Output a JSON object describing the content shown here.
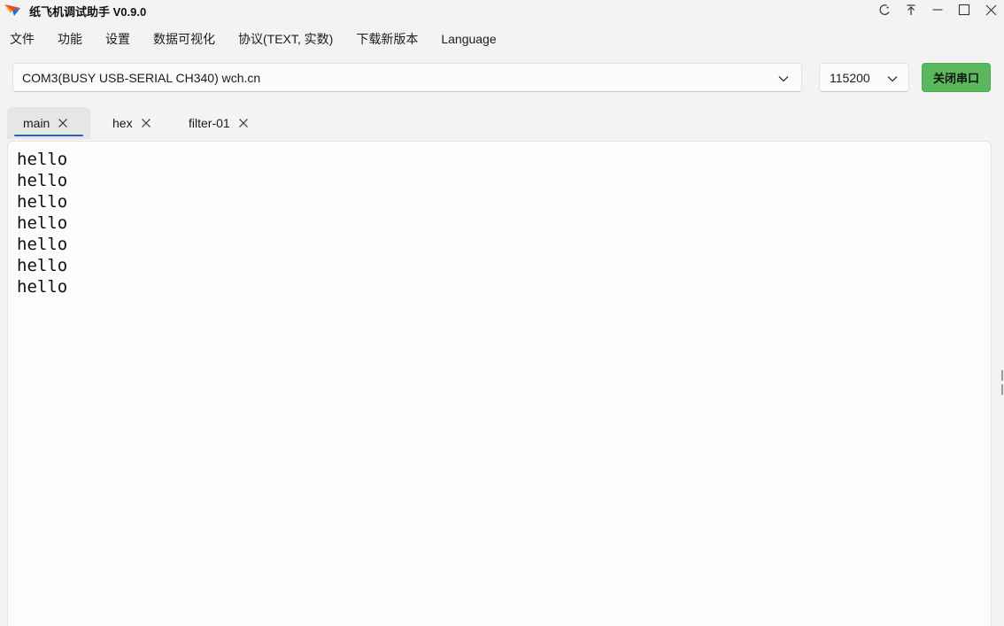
{
  "titlebar": {
    "title": "纸飞机调试助手 V0.9.0",
    "logo_icon": "paper-plane-icon",
    "controls": [
      "theme-icon",
      "pin-top-icon",
      "minimize-icon",
      "maximize-icon",
      "close-icon"
    ]
  },
  "menu": {
    "items": [
      {
        "label": "文件"
      },
      {
        "label": "功能"
      },
      {
        "label": "设置"
      },
      {
        "label": "数据可视化"
      },
      {
        "label": "协议(TEXT, 实数)"
      },
      {
        "label": "下载新版本"
      },
      {
        "label": "Language"
      }
    ]
  },
  "toolbar": {
    "port": "COM3(BUSY  USB-SERIAL CH340) wch.cn",
    "baud": "115200",
    "close_port_label": "关闭串口",
    "close_port_color": "#5cb85c"
  },
  "tabs": [
    {
      "label": "main",
      "active": true
    },
    {
      "label": "hex",
      "active": false
    },
    {
      "label": "filter-01",
      "active": false
    }
  ],
  "log": {
    "lines": [
      "hello",
      "hello",
      "hello",
      "hello",
      "hello",
      "hello",
      "hello"
    ]
  },
  "colors": {
    "accent": "#2a63b6",
    "background": "#f3f3f3"
  }
}
